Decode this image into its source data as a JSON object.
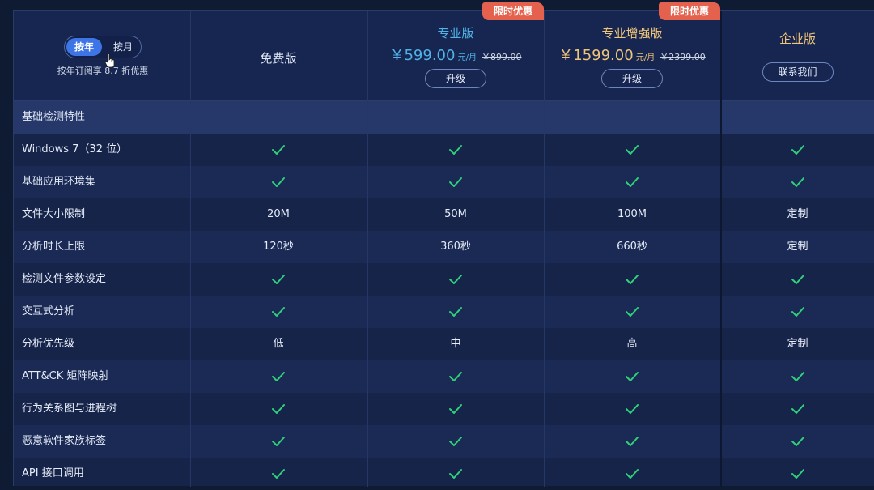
{
  "billing_toggle": {
    "annual_label": "按年",
    "monthly_label": "按月",
    "note": "按年订阅享 8.7 折优惠"
  },
  "plans": [
    {
      "name": "免费版"
    },
    {
      "name": "专业版",
      "badge": "限时优惠",
      "price": "￥599.00",
      "per": "元/月",
      "old_price": "￥899.00",
      "button": "升级",
      "name_color": "#4fb3e8"
    },
    {
      "name": "专业增强版",
      "badge": "限时优惠",
      "price": "￥1599.00",
      "per": "元/月",
      "old_price": "￥2399.00",
      "button": "升级",
      "name_color": "#f0c57a"
    },
    {
      "name": "企业版",
      "button": "联系我们",
      "name_color": "#f0c57a"
    }
  ],
  "section_title": "基础检测特性",
  "features": [
    {
      "label": "Windows 7（32 位）",
      "values": [
        "check",
        "check",
        "check",
        "check"
      ]
    },
    {
      "label": "基础应用环境集",
      "values": [
        "check",
        "check",
        "check",
        "check"
      ]
    },
    {
      "label": "文件大小限制",
      "values": [
        "20M",
        "50M",
        "100M",
        "定制"
      ]
    },
    {
      "label": "分析时长上限",
      "values": [
        "120秒",
        "360秒",
        "660秒",
        "定制"
      ]
    },
    {
      "label": "检测文件参数设定",
      "values": [
        "check",
        "check",
        "check",
        "check"
      ]
    },
    {
      "label": "交互式分析",
      "values": [
        "check",
        "check",
        "check",
        "check"
      ]
    },
    {
      "label": "分析优先级",
      "values": [
        "低",
        "中",
        "高",
        "定制"
      ]
    },
    {
      "label": "ATT&CK 矩阵映射",
      "values": [
        "check",
        "check",
        "check",
        "check"
      ]
    },
    {
      "label": "行为关系图与进程树",
      "values": [
        "check",
        "check",
        "check",
        "check"
      ]
    },
    {
      "label": "恶意软件家族标签",
      "values": [
        "check",
        "check",
        "check",
        "check"
      ]
    },
    {
      "label": "API 接口调用",
      "values": [
        "check",
        "check",
        "check",
        "check"
      ]
    }
  ],
  "colors": {
    "check": "#2fd27a",
    "badge": "#e4614d",
    "pro_accent": "#4fb3e8",
    "plus_accent": "#f0c57a"
  }
}
